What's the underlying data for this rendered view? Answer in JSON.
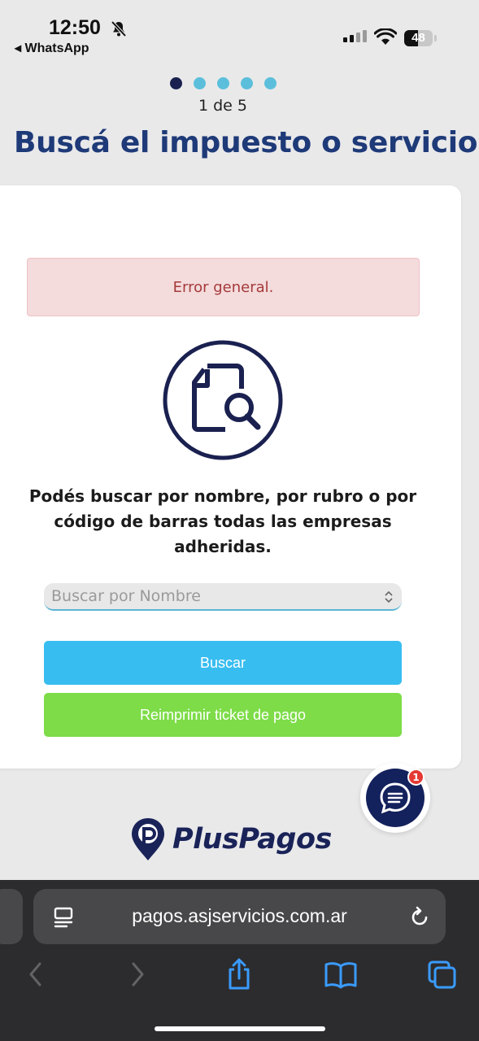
{
  "status_bar": {
    "time": "12:50",
    "back_app": "◂ WhatsApp",
    "battery": "48",
    "battery_level": 0.48
  },
  "stepper": {
    "total": 5,
    "current": 1,
    "label": "1 de 5"
  },
  "page": {
    "title": "Buscá el impuesto o servicio",
    "error": "Error general.",
    "description": "Podés buscar por nombre, por rubro o por código de barras todas las empresas adheridas.",
    "search_placeholder": "Buscar por Nombre",
    "search_button": "Buscar",
    "reprint_button": "Reimprimir ticket de pago"
  },
  "chat": {
    "badge": "1"
  },
  "brand": {
    "logo_text": "PlusPagos"
  },
  "browser": {
    "url": "pagos.asjservicios.com.ar"
  },
  "colors": {
    "title": "#1e3a78",
    "primary_button": "#38bdf0",
    "secondary_button": "#7ddc48",
    "error_bg": "#f4dbdc",
    "error_text": "#a53a3a",
    "navy": "#13215c"
  }
}
